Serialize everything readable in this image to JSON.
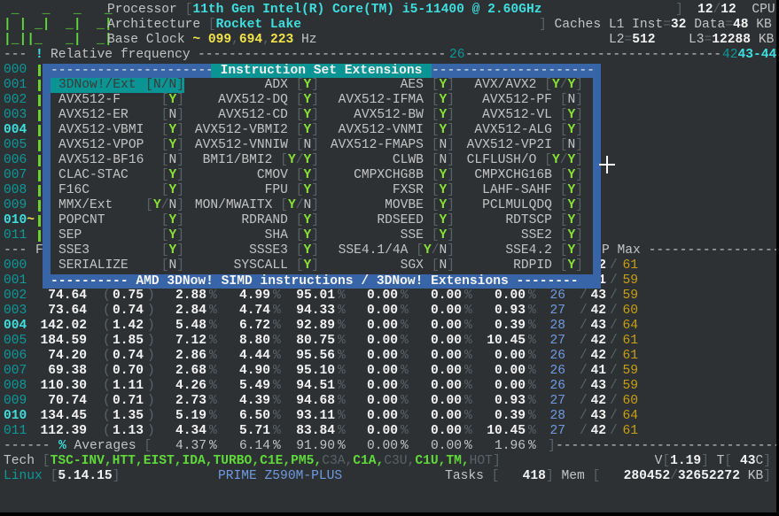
{
  "sym": {
    "lb": "[",
    "rb": "]",
    "slash": "/",
    "lp": "(",
    "rp": ")",
    "pct": "%",
    "eq": "=",
    "comma": ",",
    "tilde": "~",
    "bang": "!"
  },
  "logo": [
    " _   _   _   _",
    "| | _|  _|  _|",
    "|_||_   _|  _|"
  ],
  "header": {
    "processor_label": "Processor",
    "processor": "11th Gen Intel(R) Core(TM) i5-11400 @ 2.60GHz",
    "cpu_online": "12",
    "cpu_total": "12",
    "cpu_label": "CPU",
    "arch_label": "Architecture",
    "arch": "Rocket Lake",
    "caches_label": "Caches",
    "l1_inst_label": "L1 Inst",
    "l1_inst": "32",
    "l1_data_label": "Data",
    "l1_data": "48",
    "kb": "KB",
    "base_clock_label": "Base Clock",
    "base_clock": [
      "099",
      "694",
      "223"
    ],
    "hz": "Hz",
    "l2_label": "L2",
    "l2": "512",
    "l3_label": "L3",
    "l3": "12288"
  },
  "freq_bar": {
    "label": "Relative frequency",
    "scale_low": "26",
    "scale_mid": "42",
    "scale_high": "43-44"
  },
  "table_header": {
    "freq": "F",
    "temp": "P",
    "max": "Max"
  },
  "cores": [
    {
      "id": "000",
      "freq": "",
      "ratio": "",
      "c0": "",
      "c1": "",
      "c3": "",
      "c6": "",
      "c7": "",
      "pkg": "",
      "tmin": "",
      "temp": "2",
      "tmax": "61",
      "active": false,
      "bar": true
    },
    {
      "id": "001",
      "freq": "",
      "ratio": "",
      "c0": "",
      "c1": "",
      "c3": "",
      "c6": "",
      "c7": "",
      "pkg": "",
      "tmin": "",
      "temp": "1",
      "tmax": "59",
      "active": false,
      "bar": true
    },
    {
      "id": "002",
      "freq": "74.64",
      "ratio": "0.75",
      "c0": "2.88",
      "c1": "4.99",
      "c3": "95.01",
      "c6": "0.00",
      "c7": "0.00",
      "pkg": "0.00",
      "tmin": "26",
      "temp": "43",
      "tmax": "59",
      "active": false,
      "bar": true
    },
    {
      "id": "003",
      "freq": "73.64",
      "ratio": "0.74",
      "c0": "2.84",
      "c1": "4.74",
      "c3": "94.33",
      "c6": "0.00",
      "c7": "0.00",
      "pkg": "0.93",
      "tmin": "27",
      "temp": "42",
      "tmax": "60",
      "active": false,
      "bar": true
    },
    {
      "id": "004",
      "freq": "142.02",
      "ratio": "1.42",
      "c0": "5.48",
      "c1": "6.72",
      "c3": "92.89",
      "c6": "0.00",
      "c7": "0.00",
      "pkg": "0.39",
      "tmin": "28",
      "temp": "43",
      "tmax": "64",
      "active": true,
      "bar": true
    },
    {
      "id": "005",
      "freq": "184.59",
      "ratio": "1.85",
      "c0": "7.12",
      "c1": "8.80",
      "c3": "80.75",
      "c6": "0.00",
      "c7": "0.00",
      "pkg": "10.45",
      "tmin": "27",
      "temp": "42",
      "tmax": "61",
      "active": false,
      "bar": true
    },
    {
      "id": "006",
      "freq": "74.20",
      "ratio": "0.74",
      "c0": "2.86",
      "c1": "4.44",
      "c3": "95.56",
      "c6": "0.00",
      "c7": "0.00",
      "pkg": "0.00",
      "tmin": "26",
      "temp": "42",
      "tmax": "61",
      "active": false,
      "bar": true
    },
    {
      "id": "007",
      "freq": "69.38",
      "ratio": "0.70",
      "c0": "2.68",
      "c1": "4.90",
      "c3": "95.10",
      "c6": "0.00",
      "c7": "0.00",
      "pkg": "0.00",
      "tmin": "26",
      "temp": "41",
      "tmax": "59",
      "active": false,
      "bar": true
    },
    {
      "id": "008",
      "freq": "110.30",
      "ratio": "1.11",
      "c0": "4.26",
      "c1": "5.49",
      "c3": "94.51",
      "c6": "0.00",
      "c7": "0.00",
      "pkg": "0.00",
      "tmin": "26",
      "temp": "43",
      "tmax": "59",
      "active": false,
      "bar": true
    },
    {
      "id": "009",
      "freq": "70.74",
      "ratio": "0.71",
      "c0": "2.73",
      "c1": "4.39",
      "c3": "94.68",
      "c6": "0.00",
      "c7": "0.00",
      "pkg": "0.93",
      "tmin": "27",
      "temp": "42",
      "tmax": "60",
      "active": false,
      "bar": true
    },
    {
      "id": "010",
      "freq": "134.45",
      "ratio": "1.35",
      "c0": "5.19",
      "c1": "6.50",
      "c3": "93.11",
      "c6": "0.00",
      "c7": "0.00",
      "pkg": "0.39",
      "tmin": "28",
      "temp": "43",
      "tmax": "64",
      "active": true,
      "marker": "~",
      "bar": true
    },
    {
      "id": "011",
      "freq": "112.39",
      "ratio": "1.13",
      "c0": "4.34",
      "c1": "5.71",
      "c3": "83.84",
      "c6": "0.00",
      "c7": "0.00",
      "pkg": "10.45",
      "tmin": "27",
      "temp": "42",
      "tmax": "61",
      "active": false,
      "bar": true
    }
  ],
  "averages": {
    "label": "Averages",
    "c0": "4.37",
    "c1": "6.14",
    "c3": "91.90",
    "c6": "0.00",
    "c7": "0.00",
    "pkg": "1.96"
  },
  "tech": {
    "label": "Tech",
    "items": [
      {
        "name": "TSC-INV",
        "on": true
      },
      {
        "name": "HTT",
        "on": true
      },
      {
        "name": "EIST",
        "on": true
      },
      {
        "name": "IDA",
        "on": true
      },
      {
        "name": "TURBO",
        "on": true
      },
      {
        "name": "C1E",
        "on": true
      },
      {
        "name": "PM5",
        "on": true
      },
      {
        "name": "C3A",
        "on": false
      },
      {
        "name": "C1A",
        "on": true
      },
      {
        "name": "C3U",
        "on": false
      },
      {
        "name": "C1U",
        "on": true
      },
      {
        "name": "TM",
        "on": true
      },
      {
        "name": "HOT",
        "on": false
      }
    ],
    "voltage_label": "V",
    "voltage": "1.19",
    "temp_label": "T",
    "temp": "43",
    "temp_unit": "C"
  },
  "status": {
    "os": "Linux",
    "kernel": "5.14.15",
    "board": "PRIME Z590M-PLUS",
    "tasks_label": "Tasks",
    "tasks": "418",
    "mem_label": "Mem",
    "mem_used": "280452",
    "mem_total": "32652272",
    "mem_unit": "KB"
  },
  "popup": {
    "title": "Instruction Set Extensions",
    "footer": "AMD 3DNow! SIMD instructions / 3DNow! Extensions",
    "selected_index": 0,
    "items": [
      {
        "label": "3DNow!/Ext",
        "flag": "N/N"
      },
      {
        "label": "ADX",
        "flag": "Y"
      },
      {
        "label": "AES",
        "flag": "Y"
      },
      {
        "label": "AVX/AVX2",
        "flag": "Y/Y"
      },
      {
        "label": "AVX512-F",
        "flag": "Y"
      },
      {
        "label": "AVX512-DQ",
        "flag": "Y"
      },
      {
        "label": "AVX512-IFMA",
        "flag": "Y"
      },
      {
        "label": "AVX512-PF",
        "flag": "N"
      },
      {
        "label": "AVX512-ER",
        "flag": "N"
      },
      {
        "label": "AVX512-CD",
        "flag": "Y"
      },
      {
        "label": "AVX512-BW",
        "flag": "Y"
      },
      {
        "label": "AVX512-VL",
        "flag": "Y"
      },
      {
        "label": "AVX512-VBMI",
        "flag": "Y"
      },
      {
        "label": "AVX512-VBMI2",
        "flag": "Y"
      },
      {
        "label": "AVX512-VNMI",
        "flag": "Y"
      },
      {
        "label": "AVX512-ALG",
        "flag": "Y"
      },
      {
        "label": "AVX512-VPOP",
        "flag": "Y"
      },
      {
        "label": "AVX512-VNNIW",
        "flag": "N"
      },
      {
        "label": "AVX512-FMAPS",
        "flag": "N"
      },
      {
        "label": "AVX512-VP2I",
        "flag": "N"
      },
      {
        "label": "AVX512-BF16",
        "flag": "N"
      },
      {
        "label": "BMI1/BMI2",
        "flag": "Y/Y"
      },
      {
        "label": "CLWB",
        "flag": "N"
      },
      {
        "label": "CLFLUSH/O",
        "flag": "Y/Y"
      },
      {
        "label": "CLAC-STAC",
        "flag": "Y"
      },
      {
        "label": "CMOV",
        "flag": "Y"
      },
      {
        "label": "CMPXCHG8B",
        "flag": "Y"
      },
      {
        "label": "CMPXCHG16B",
        "flag": "Y"
      },
      {
        "label": "F16C",
        "flag": "Y"
      },
      {
        "label": "FPU",
        "flag": "Y"
      },
      {
        "label": "FXSR",
        "flag": "Y"
      },
      {
        "label": "LAHF-SAHF",
        "flag": "Y"
      },
      {
        "label": "MMX/Ext",
        "flag": "Y/N"
      },
      {
        "label": "MON/MWAITX",
        "flag": "Y/N"
      },
      {
        "label": "MOVBE",
        "flag": "Y"
      },
      {
        "label": "PCLMULQDQ",
        "flag": "Y"
      },
      {
        "label": "POPCNT",
        "flag": "Y"
      },
      {
        "label": "RDRAND",
        "flag": "Y"
      },
      {
        "label": "RDSEED",
        "flag": "Y"
      },
      {
        "label": "RDTSCP",
        "flag": "Y"
      },
      {
        "label": "SEP",
        "flag": "Y"
      },
      {
        "label": "SHA",
        "flag": "Y"
      },
      {
        "label": "SSE",
        "flag": "Y"
      },
      {
        "label": "SSE2",
        "flag": "Y"
      },
      {
        "label": "SSE3",
        "flag": "Y"
      },
      {
        "label": "SSSE3",
        "flag": "Y"
      },
      {
        "label": "SSE4.1/4A",
        "flag": "Y/N"
      },
      {
        "label": "SSE4.2",
        "flag": "Y"
      },
      {
        "label": "SERIALIZE",
        "flag": "N"
      },
      {
        "label": "SYSCALL",
        "flag": "Y"
      },
      {
        "label": "SGX",
        "flag": "N"
      },
      {
        "label": "RDPID",
        "flag": "Y"
      }
    ]
  }
}
